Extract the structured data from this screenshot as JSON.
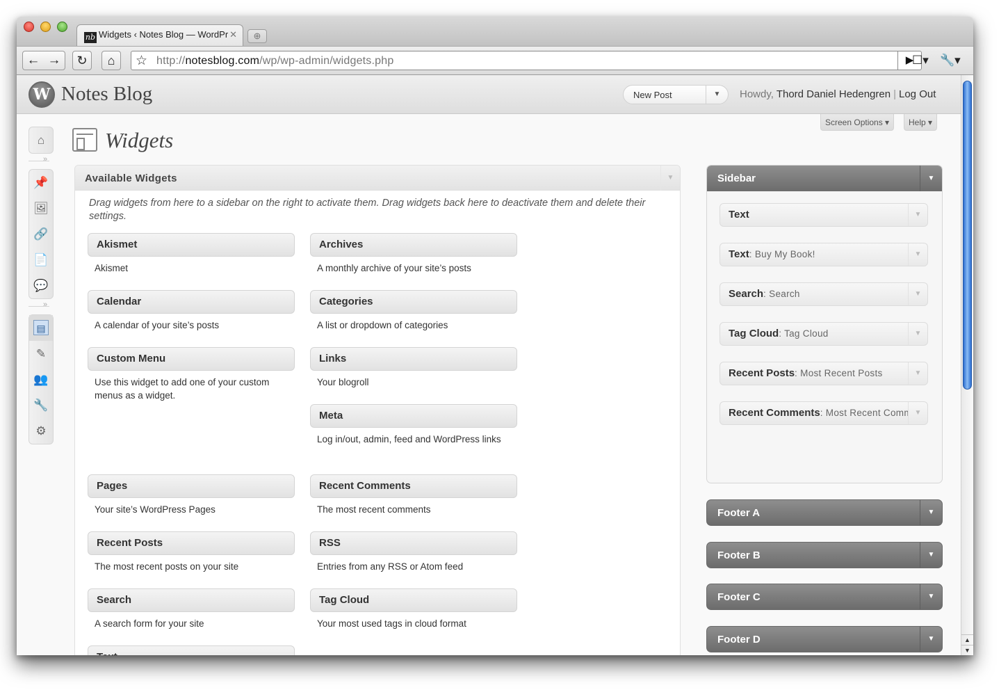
{
  "browser": {
    "tab_favicon": "nb",
    "tab_title": "Widgets ‹ Notes Blog — WordPress",
    "tab_close": "✕",
    "new_tab": "⊕",
    "url_scheme": "http://",
    "url_host": "notesblog.com",
    "url_path": "/wp/wp-admin/widgets.php",
    "icons": {
      "back": "←",
      "forward": "→",
      "reload": "↻",
      "home": "⌂",
      "bookmark": "☆",
      "go": "▶",
      "page_menu": "☐▾",
      "wrench_menu": "🔧▾"
    }
  },
  "header": {
    "logo": "W",
    "site_name": "Notes Blog",
    "favorite_action": "New Post",
    "favorite_toggle": "▼",
    "howdy": "Howdy,",
    "user_name": "Thord Daniel Hedengren",
    "separator": "|",
    "logout": "Log Out"
  },
  "screen_meta": {
    "screen_options": "Screen Options ▾",
    "help": "Help ▾"
  },
  "admin_menu": {
    "group1": [
      "⌂"
    ],
    "group2": [
      "📌",
      "🖼",
      "🔗",
      "📄",
      "💬"
    ],
    "group3": [
      "▤",
      "✎",
      "👥",
      "🔧",
      "⚙"
    ]
  },
  "page": {
    "title": "Widgets"
  },
  "available": {
    "title": "Available Widgets",
    "toggle": "▼",
    "description": "Drag widgets from here to a sidebar on the right to activate them. Drag widgets back here to deactivate them and delete their settings.",
    "widgets": [
      {
        "title": "Akismet",
        "desc": "Akismet"
      },
      {
        "title": "Archives",
        "desc": "A monthly archive of your site’s posts"
      },
      {
        "title": "Calendar",
        "desc": "A calendar of your site’s posts"
      },
      {
        "title": "Categories",
        "desc": "A list or dropdown of categories"
      },
      {
        "title": "Custom Menu",
        "desc": "Use this widget to add one of your custom menus as a widget."
      },
      {
        "title": "Links",
        "desc": "Your blogroll"
      },
      {
        "title": "Meta",
        "desc": "Log in/out, admin, feed and WordPress links"
      },
      {
        "title": "Pages",
        "desc": "Your site’s WordPress Pages"
      },
      {
        "title": "Recent Comments",
        "desc": "The most recent comments"
      },
      {
        "title": "Recent Posts",
        "desc": "The most recent posts on your site"
      },
      {
        "title": "RSS",
        "desc": "Entries from any RSS or Atom feed"
      },
      {
        "title": "Search",
        "desc": "A search form for your site"
      },
      {
        "title": "Tag Cloud",
        "desc": "Your most used tags in cloud format"
      },
      {
        "title": "Text",
        "desc": ""
      }
    ]
  },
  "sidebar": {
    "title": "Sidebar",
    "toggle": "▼",
    "widgets": [
      {
        "name": "Text",
        "sub": ""
      },
      {
        "name": "Text",
        "sub": ": Buy My Book!"
      },
      {
        "name": "Search",
        "sub": ": Search"
      },
      {
        "name": "Tag Cloud",
        "sub": ": Tag Cloud"
      },
      {
        "name": "Recent Posts",
        "sub": ": Most Recent Posts"
      },
      {
        "name": "Recent Comments",
        "sub": ": Most Recent Comments"
      }
    ],
    "widget_toggle": "▼"
  },
  "footers": [
    {
      "title": "Footer A",
      "toggle": "▼"
    },
    {
      "title": "Footer B",
      "toggle": "▼"
    },
    {
      "title": "Footer C",
      "toggle": "▼"
    },
    {
      "title": "Footer D",
      "toggle": "▼"
    }
  ],
  "scrollbar": {
    "up": "▲",
    "down": "▼"
  }
}
